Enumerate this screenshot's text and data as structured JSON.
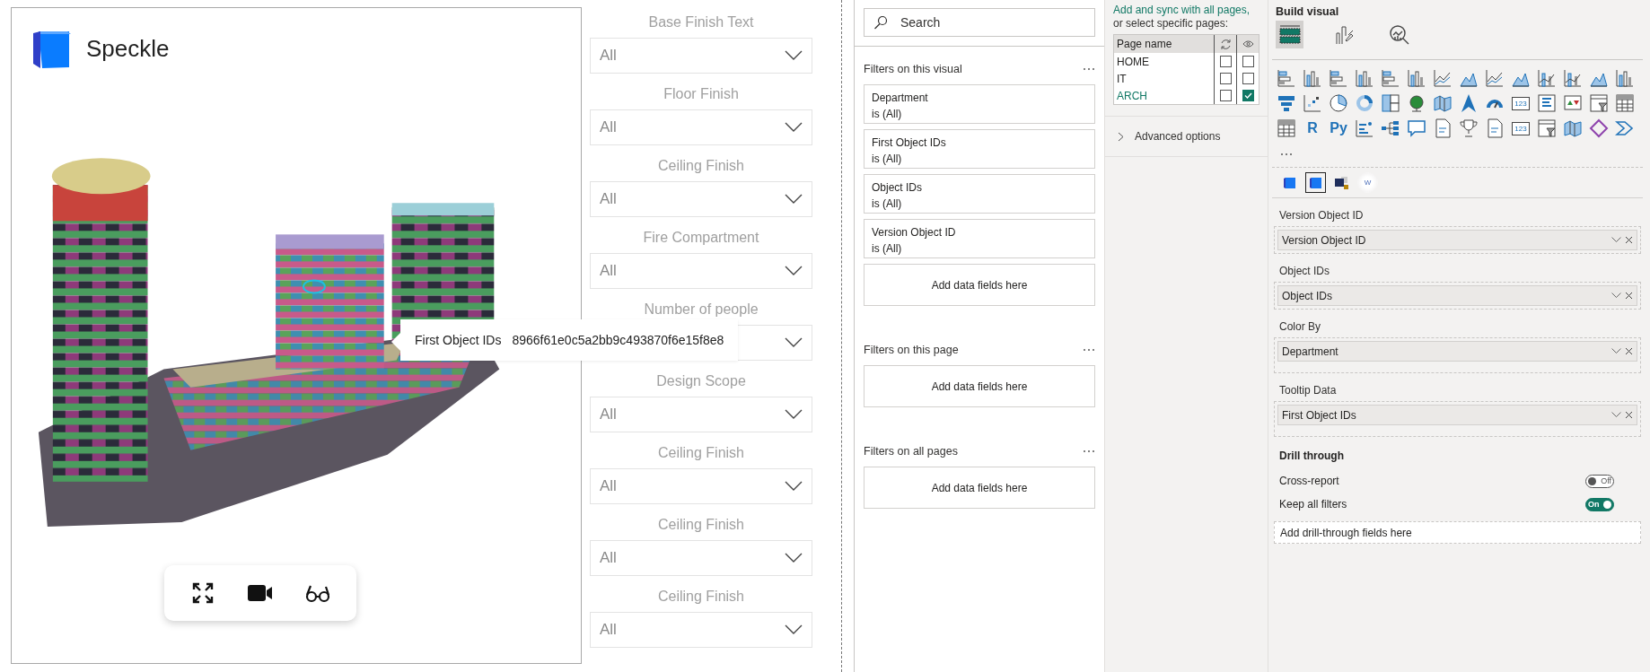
{
  "report_visual": {
    "title": "Speckle",
    "tooltip": {
      "label": "First Object IDs",
      "value": "8966f61e0c5a2bb9c493870f6e15f8e8"
    },
    "toolbar": [
      {
        "kind": "fullscreen"
      },
      {
        "kind": "camera"
      },
      {
        "kind": "glasses"
      }
    ]
  },
  "slicers": [
    {
      "title": "Base Finish Text",
      "value": "All"
    },
    {
      "title": "Floor Finish",
      "value": "All"
    },
    {
      "title": "Ceiling Finish",
      "value": "All"
    },
    {
      "title": "Fire Compartment",
      "value": "All"
    },
    {
      "title": "Number of people"
    },
    {
      "title": "Design Scope",
      "value": "All"
    },
    {
      "title": "Ceiling Finish",
      "value": "All"
    },
    {
      "title": "Ceiling Finish",
      "value": "All"
    },
    {
      "title": "Ceiling Finish",
      "value": "All"
    }
  ],
  "filters_pane": {
    "search": {
      "placeholder": "Search"
    },
    "sections": [
      {
        "title": "Filters on this visual",
        "filters": [
          {
            "name": "Department",
            "condition": "is (All)"
          },
          {
            "name": "First Object IDs",
            "condition": "is (All)"
          },
          {
            "name": "Object IDs",
            "condition": "is (All)"
          },
          {
            "name": "Version Object ID",
            "condition": "is (All)"
          }
        ],
        "add_label": "Add data fields here"
      },
      {
        "title": "Filters on this page",
        "add_label": "Add data fields here"
      },
      {
        "title": "Filters on all pages",
        "add_label": "Add data fields here"
      }
    ]
  },
  "sync_pane": {
    "intro_link": "Add and sync with all pages,",
    "intro": "or select specific pages:",
    "column": "Page name",
    "pages": [
      {
        "name": "HOME",
        "sync": false,
        "visible": false,
        "current": false
      },
      {
        "name": "IT",
        "sync": false,
        "visible": false,
        "current": false
      },
      {
        "name": "ARCH",
        "sync": false,
        "visible": true,
        "current": true
      }
    ],
    "advanced": {
      "label": "Advanced options",
      "expanded": false
    }
  },
  "build_pane": {
    "title": "Build visual",
    "tabs": [
      {
        "kind": "fields",
        "selected": true
      },
      {
        "kind": "format",
        "selected": false
      },
      {
        "kind": "analytics",
        "selected": false
      }
    ],
    "gallery": [
      {
        "kind": "hbar"
      },
      {
        "kind": "vbar"
      },
      {
        "kind": "hbar"
      },
      {
        "kind": "vbar"
      },
      {
        "kind": "hbar"
      },
      {
        "kind": "vbar"
      },
      {
        "kind": "line"
      },
      {
        "kind": "area"
      },
      {
        "kind": "line"
      },
      {
        "kind": "area"
      },
      {
        "kind": "combo"
      },
      {
        "kind": "combo"
      },
      {
        "kind": "area"
      },
      {
        "kind": "vbar"
      },
      {
        "kind": "funnel"
      },
      {
        "kind": "scatter"
      },
      {
        "kind": "pie"
      },
      {
        "kind": "donut"
      },
      {
        "kind": "treemap"
      },
      {
        "kind": "globe"
      },
      {
        "kind": "map"
      },
      {
        "kind": "arrow"
      },
      {
        "kind": "gauge"
      },
      {
        "kind": "card",
        "label": "123"
      },
      {
        "kind": "list"
      },
      {
        "kind": "kpi"
      },
      {
        "kind": "slicer"
      },
      {
        "kind": "table"
      },
      {
        "kind": "table"
      },
      {
        "kind": "text",
        "label": "R"
      },
      {
        "kind": "text",
        "label": "Py"
      },
      {
        "kind": "influencer"
      },
      {
        "kind": "tree"
      },
      {
        "kind": "bubble"
      },
      {
        "kind": "doc"
      },
      {
        "kind": "trophy"
      },
      {
        "kind": "doc"
      },
      {
        "kind": "card",
        "label": "123"
      },
      {
        "kind": "slicer"
      },
      {
        "kind": "map"
      },
      {
        "kind": "diamond"
      },
      {
        "kind": "chevron"
      }
    ],
    "custom_visuals": [
      {
        "kind": "cube",
        "selected": false
      },
      {
        "kind": "cube",
        "selected": true
      },
      {
        "kind": "layers",
        "selected": false
      },
      {
        "kind": "cloud",
        "label": "W",
        "selected": false
      }
    ],
    "wells": [
      {
        "label": "Version Object ID",
        "field": "Version Object ID"
      },
      {
        "label": "Object IDs",
        "field": "Object IDs"
      },
      {
        "label": "Color By",
        "field": "Department"
      },
      {
        "label": "Tooltip Data",
        "field": "First Object IDs"
      }
    ],
    "drill": {
      "title": "Drill through",
      "toggles": [
        {
          "label": "Cross-report",
          "on": false,
          "state_text": "Off"
        },
        {
          "label": "Keep all filters",
          "on": true,
          "state_text": "On"
        }
      ],
      "add_label": "Add drill-through fields here"
    }
  }
}
